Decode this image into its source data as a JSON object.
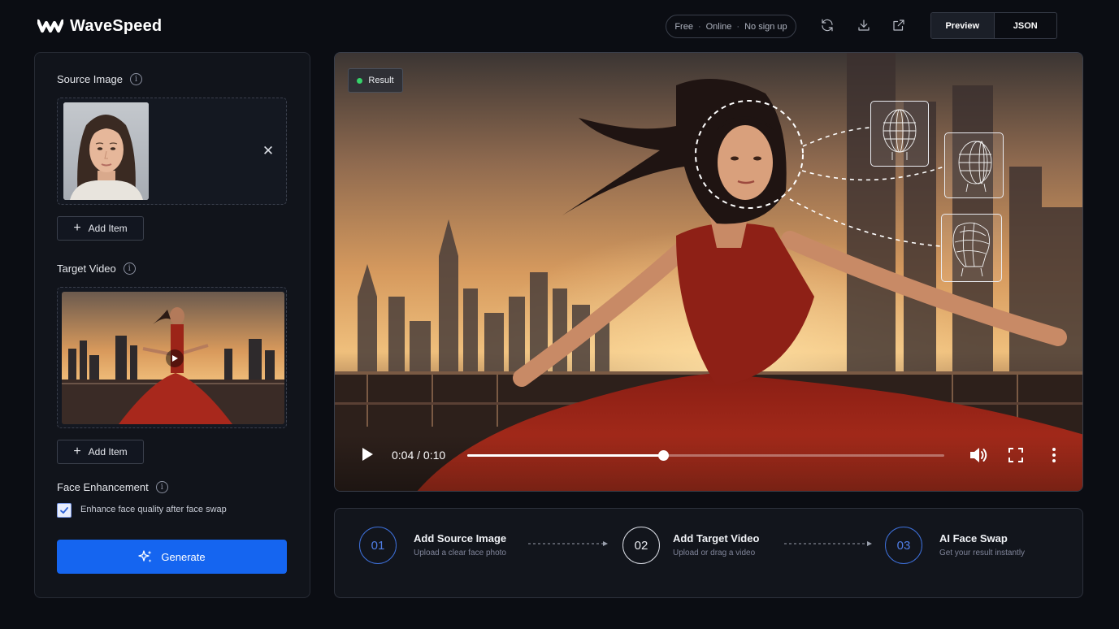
{
  "header": {
    "logo_text": "WaveSpeed",
    "pill": {
      "item1": "Free",
      "sep": "·",
      "item2": "Online",
      "item3": "No sign up"
    },
    "icons": [
      "refresh-icon",
      "download-icon",
      "external-link-icon"
    ],
    "view_tabs": [
      {
        "label": "Preview",
        "active": true
      },
      {
        "label": "JSON",
        "active": false
      }
    ]
  },
  "left_panel": {
    "source_image": {
      "label": "Source Image",
      "add_item": "Add Item"
    },
    "target_video": {
      "label": "Target Video",
      "add_item": "Add Item"
    },
    "face_enhancement": {
      "label": "Face Enhancement",
      "checkbox_label": "Enhance face quality after face swap",
      "checked": true
    },
    "generate_label": "Generate"
  },
  "video": {
    "badge": "Result",
    "time": "0:04 / 0:10",
    "progress": 0.41
  },
  "steps": [
    {
      "num": "01",
      "title": "Add Source Image",
      "sub": "Upload a clear face photo"
    },
    {
      "num": "02",
      "title": "Add Target Video",
      "sub": "Upload or drag a video"
    },
    {
      "num": "03",
      "title": "AI Face Swap",
      "sub": "Get your result instantly"
    }
  ],
  "colors": {
    "accent": "#1565f0",
    "badge_dot": "#36d26a",
    "step_blue": "#3d6fd8"
  }
}
